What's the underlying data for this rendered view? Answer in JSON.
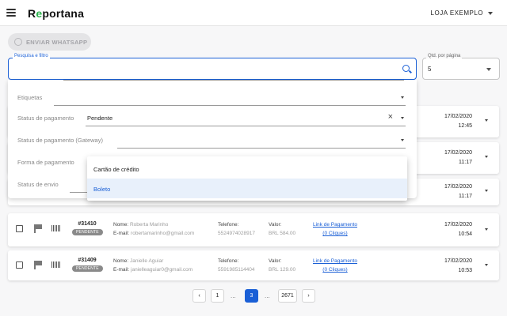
{
  "header": {
    "logo_prefix": "R",
    "logo_e": "e",
    "logo_rest": "portana",
    "store": "LOJA EXEMPLO"
  },
  "whatsapp_button": "ENVIAR WHATSAPP",
  "search": {
    "label": "Pesquisa e filtro",
    "value": ""
  },
  "qty": {
    "label": "Qtd. por página",
    "value": "5"
  },
  "filters": {
    "etiquetas": "Etiquetas",
    "status_pagamento": "Status de pagamento",
    "status_pagamento_value": "Pendente",
    "status_gateway": "Status de pagamento (Gateway)",
    "forma_pagamento": "Forma de pagamento",
    "status_envio": "Status de envio",
    "clear": "×"
  },
  "dropdown": {
    "options": [
      "Cartão de crédito",
      "Boleto"
    ],
    "selected": "Boleto"
  },
  "hidden_cards": [
    {
      "date": "17/02/2020",
      "time": "12:45"
    },
    {
      "date": "17/02/2020",
      "time": "11:17"
    },
    {
      "date": "17/02/2020",
      "time": "11:17"
    }
  ],
  "orders": [
    {
      "number": "#31410",
      "status": "PENDENTE",
      "name_label": "Nome:",
      "name": "Roberta Marinho",
      "email_label": "E-mail:",
      "email": "robertamarinho@gmail.com",
      "phone_label": "Telefone:",
      "phone": "5524974028917",
      "value_label": "Valor:",
      "value": "BRL 584.00",
      "link": "Link de Pagamento",
      "clicks": "(0 Cliques)",
      "date": "17/02/2020",
      "time": "10:54"
    },
    {
      "number": "#31409",
      "status": "PENDENTE",
      "name_label": "Nome:",
      "name": "Janielle Aguiar",
      "email_label": "E-mail:",
      "email": "janielleaguiar0@gmail.com",
      "phone_label": "Telefone:",
      "phone": "5591985114404",
      "value_label": "Valor:",
      "value": "BRL 129.00",
      "link": "Link de Pagamento",
      "clicks": "(0 Cliques)",
      "date": "17/02/2020",
      "time": "10:53"
    }
  ],
  "pagination": {
    "prev": "‹",
    "first": "1",
    "ellipsis": "...",
    "current": "3",
    "last": "2671",
    "next": "›"
  },
  "colors": {
    "accent": "#1a5fd6",
    "brand_green": "#2bb24c"
  }
}
